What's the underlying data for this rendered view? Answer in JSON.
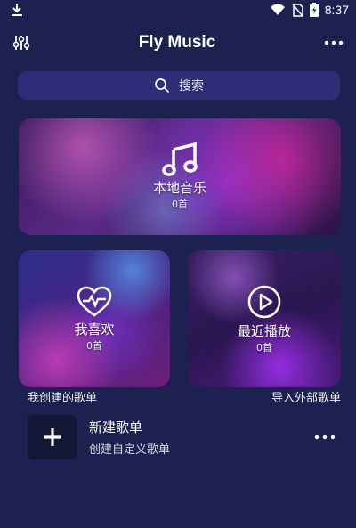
{
  "status_bar": {
    "time": "8:37",
    "icons": [
      "download-icon",
      "wifi-icon",
      "no-sim-icon",
      "battery-icon"
    ]
  },
  "header": {
    "title": "Fly Music",
    "left_icon": "equalizer-icon",
    "right_icon": "more-icon"
  },
  "search": {
    "placeholder": "搜索",
    "icon": "search-icon"
  },
  "cards": {
    "local": {
      "label": "本地音乐",
      "count": "0首",
      "icon": "music-note-icon"
    },
    "favorites": {
      "label": "我喜欢",
      "count": "0首",
      "icon": "heart-pulse-icon"
    },
    "recent": {
      "label": "最近播放",
      "count": "0首",
      "icon": "play-circle-icon"
    }
  },
  "sections": {
    "my_playlists": "我创建的歌单",
    "import_playlists": "导入外部歌单"
  },
  "new_playlist": {
    "title": "新建歌单",
    "subtitle": "创建自定义歌单",
    "icon": "plus-icon",
    "more_icon": "more-icon"
  },
  "colors": {
    "background": "#1c2150",
    "search_bg": "#2f2c78",
    "accent": "#8a3cff"
  }
}
